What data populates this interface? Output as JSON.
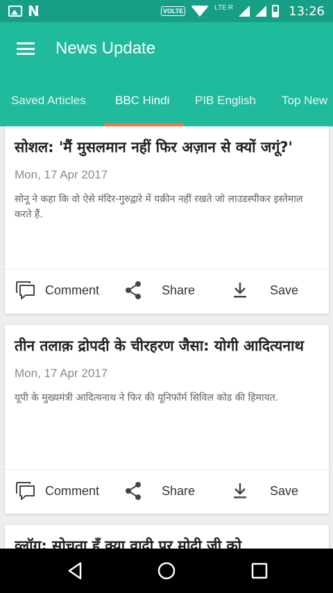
{
  "status_bar": {
    "network_badge": "VOLTE",
    "network_type": "LTE",
    "roaming_flag": "R",
    "time": "13:26"
  },
  "app_bar": {
    "title": "News Update",
    "menu_icon": "hamburger-menu-icon"
  },
  "tabs": [
    {
      "label": "Saved Articles",
      "active": false
    },
    {
      "label": "BBC Hindi",
      "active": true
    },
    {
      "label": "PIB English",
      "active": false
    },
    {
      "label": "Top New",
      "active": false
    }
  ],
  "articles": [
    {
      "title": "सोशल: 'मैं मुसलमान नहीं फिर अज़ान से क्यों जगूं?'",
      "date": "Mon, 17 Apr 2017",
      "summary": "सोनू ने कहा कि वो ऐसे मंदिर-गुरुद्वारे में यक़ीन नहीं रखते जो लाउडस्पीकर इस्तेमाल करते हैं."
    },
    {
      "title": "तीन तलाक़ द्रोपदी के चीरहरण जैसा: योगी आदित्यनाथ",
      "date": "Mon, 17 Apr 2017",
      "summary": "यूपी के मुख्यमंत्री आदित्यनाथ ने फिर की यूनिफॉर्म सिविल कोड की हिमायत."
    },
    {
      "title": "व्लॉग: सोचता हूँ क्या वादी पर मोदी जी को"
    }
  ],
  "actions": {
    "comment": "Comment",
    "share": "Share",
    "save": "Save"
  },
  "colors": {
    "status_bar": "#179f86",
    "primary": "#20bb9c",
    "tab_indicator": "#ff7043"
  }
}
